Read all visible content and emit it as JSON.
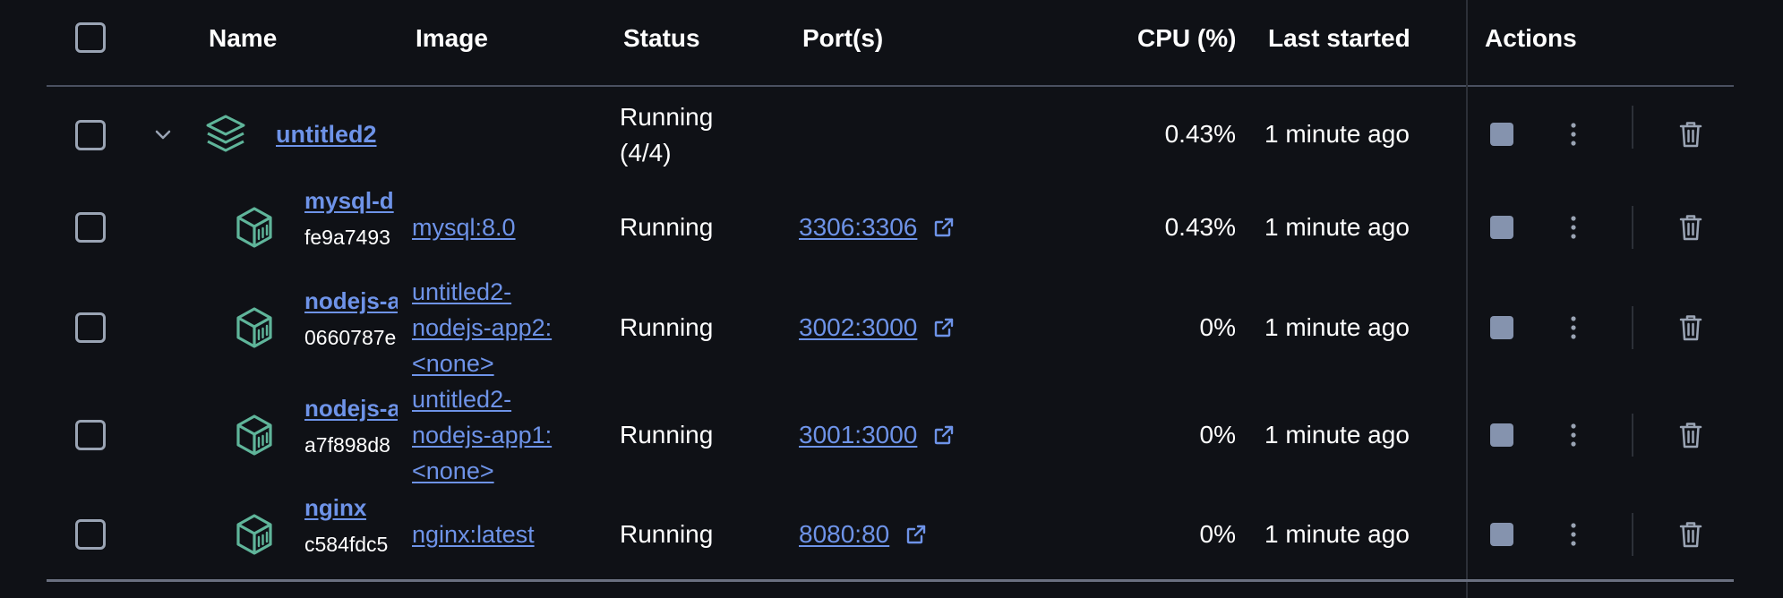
{
  "header": {
    "name": "Name",
    "image": "Image",
    "status": "Status",
    "ports": "Port(s)",
    "cpu": "CPU (%)",
    "last_started": "Last started",
    "actions": "Actions"
  },
  "group": {
    "name": "untitled2",
    "status_line1": "Running",
    "status_line2": "(4/4)",
    "cpu": "0.43%",
    "last_started": "1 minute ago"
  },
  "containers": [
    {
      "name": "mysql-d",
      "id": "fe9a7493",
      "image_lines": [
        "mysql:8.0"
      ],
      "status": "Running",
      "port": "3306:3306",
      "cpu": "0.43%",
      "last_started": "1 minute ago"
    },
    {
      "name": "nodejs-a",
      "id": "0660787e",
      "image_lines": [
        "untitled2-",
        "nodejs-app2:",
        "<none>"
      ],
      "status": "Running",
      "port": "3002:3000",
      "cpu": "0%",
      "last_started": "1 minute ago"
    },
    {
      "name": "nodejs-a",
      "id": "a7f898d8",
      "image_lines": [
        "untitled2-",
        "nodejs-app1:",
        "<none>"
      ],
      "status": "Running",
      "port": "3001:3000",
      "cpu": "0%",
      "last_started": "1 minute ago"
    },
    {
      "name": "nginx",
      "id": "c584fdc5",
      "image_lines": [
        "nginx:latest"
      ],
      "status": "Running",
      "port": "8080:80",
      "cpu": "0%",
      "last_started": "1 minute ago"
    }
  ],
  "colors": {
    "background": "#0f1116",
    "link": "#6e93e8",
    "icon_green": "#5fb59a",
    "stop_button": "#8593ae",
    "action_icon": "#9aa4b4"
  },
  "icons": {
    "group": "stack-layers-icon",
    "container": "container-box-icon",
    "expand": "chevron-down-icon",
    "external": "external-link-icon",
    "stop": "stop-icon",
    "more": "kebab-menu-icon",
    "delete": "trash-icon"
  }
}
